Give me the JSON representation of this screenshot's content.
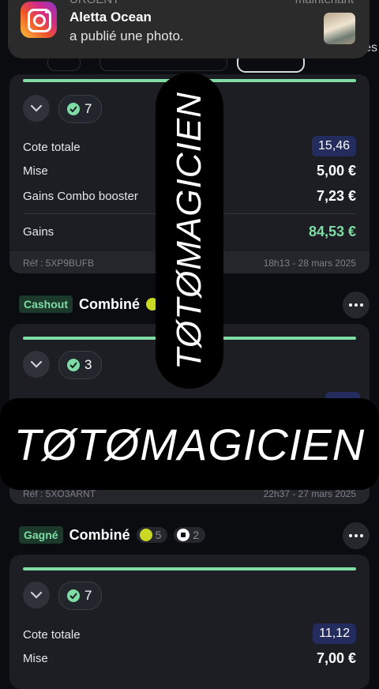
{
  "notification": {
    "category": "URGENT",
    "time": "maintenant",
    "title": "Aletta Ocean",
    "message": "a publié une photo.",
    "app_icon": "instagram-icon"
  },
  "top_tab_partial": "es",
  "watermark": {
    "text": "TØTØMAGICIEN"
  },
  "colors": {
    "green": "#7fdca4",
    "odds_bg": "#232c5c",
    "card_bg": "#1c1e24",
    "page_bg": "#0b0c10"
  },
  "bet1": {
    "selections": "7",
    "cote_label": "Cote totale",
    "cote_value": "15,46",
    "mise_label": "Mise",
    "mise_value": "5,00 €",
    "booster_label": "Gains Combo booster",
    "booster_value": "7,23 €",
    "gains_label": "Gains",
    "gains_value": "84,53 €",
    "ref": "Réf : 5XP9BUFB",
    "date": "18h13 - 28 mars 2025"
  },
  "bet2": {
    "status": "Cashout",
    "type": "Combiné",
    "sport_icon": "tennis-ball-icon",
    "selections": "3",
    "ref": "Réf : 5XO3ARNT",
    "date": "22h37 - 27 mars 2025"
  },
  "bet3": {
    "status": "Gagné",
    "type": "Combiné",
    "tennis_count": "5",
    "football_count": "2",
    "selections": "7",
    "cote_label": "Cote totale",
    "cote_value": "11,12",
    "mise_label": "Mise",
    "mise_value": "7,00 €"
  }
}
